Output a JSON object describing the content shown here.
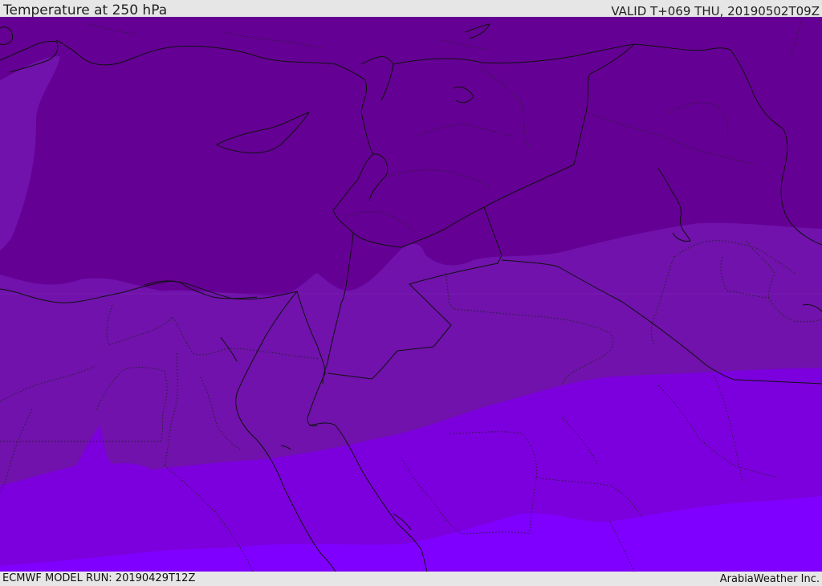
{
  "header": {
    "title": "Temperature at 250 hPa",
    "valid_time": "VALID T+069 THU, 20190502T09Z"
  },
  "footer": {
    "model_run": "ECMWF MODEL RUN: 20190429T12Z",
    "credit": "ArabiaWeather Inc."
  },
  "colors": {
    "band_darkest": "#650094",
    "band_mid": "#7012ab",
    "band_bright": "#7c00dd",
    "band_brightest": "#7f00ff",
    "boundary_line": "#111111"
  }
}
